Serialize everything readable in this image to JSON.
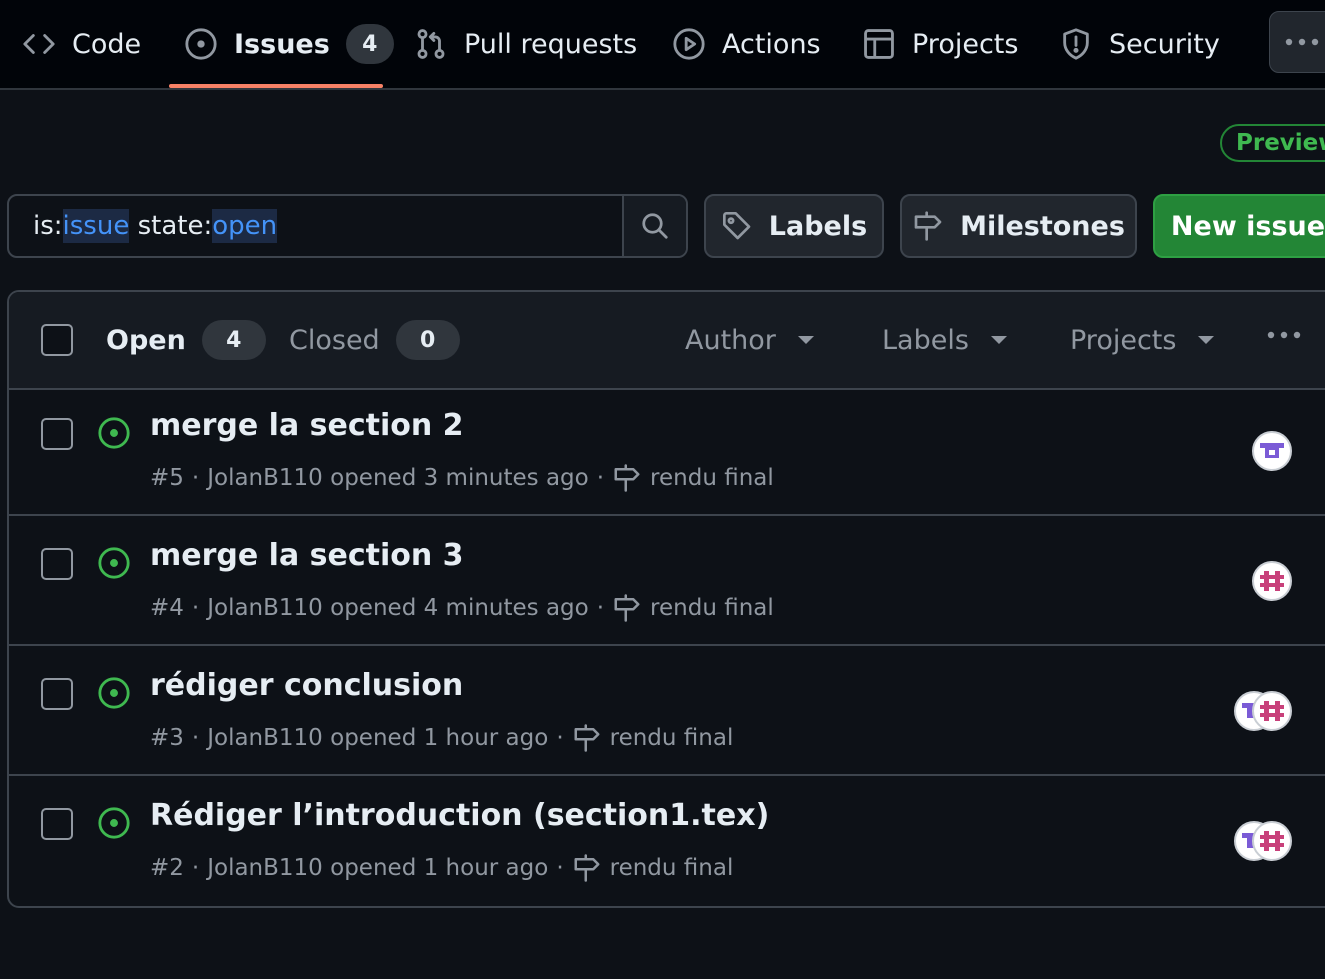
{
  "repo_nav": {
    "tabs": [
      {
        "label": "Code",
        "icon": "code-icon"
      },
      {
        "label": "Issues",
        "icon": "issue-opened-icon",
        "count": "4"
      },
      {
        "label": "Pull requests",
        "icon": "git-pull-request-icon"
      },
      {
        "label": "Actions",
        "icon": "play-icon"
      },
      {
        "label": "Projects",
        "icon": "table-icon"
      },
      {
        "label": "Security",
        "icon": "shield-icon"
      }
    ],
    "selected_tab": "Issues",
    "overflow_icon": "kebab-horizontal-icon"
  },
  "preview_badge": "Preview",
  "search": {
    "tokens": [
      {
        "key": "is:",
        "value": "issue"
      },
      {
        "key": "state:",
        "value": "open"
      }
    ],
    "button_icon": "search-icon"
  },
  "actions": {
    "labels": "Labels",
    "milestones": "Milestones",
    "new_issue": "New issue"
  },
  "list_header": {
    "open_label": "Open",
    "open_count": "4",
    "closed_label": "Closed",
    "closed_count": "0",
    "filters": [
      "Author",
      "Labels",
      "Projects"
    ],
    "more_icon": "kebab-horizontal-icon"
  },
  "issues": [
    {
      "title": "merge la section 2",
      "number": "#5",
      "author": "JolanB110",
      "opened": "opened 3 minutes ago",
      "milestone": "rendu final",
      "assignees": [
        "purple-identicon"
      ]
    },
    {
      "title": "merge la section 3",
      "number": "#4",
      "author": "JolanB110",
      "opened": "opened 4 minutes ago",
      "milestone": "rendu final",
      "assignees": [
        "pink-identicon"
      ]
    },
    {
      "title": "rédiger conclusion",
      "number": "#3",
      "author": "JolanB110",
      "opened": "opened 1 hour ago",
      "milestone": "rendu final",
      "assignees": [
        "purple-identicon",
        "pink-identicon"
      ]
    },
    {
      "title": "Rédiger l’introduction (section1.tex)",
      "number": "#2",
      "author": "JolanB110",
      "opened": "opened 1 hour ago",
      "milestone": "rendu final",
      "assignees": [
        "purple-identicon",
        "pink-identicon"
      ]
    }
  ],
  "colors": {
    "background": "#0d1117",
    "open_issue_green": "#3fb950",
    "primary_button": "#238636",
    "selected_tab_underline": "#f78166",
    "search_token_blue": "#4493f8"
  }
}
